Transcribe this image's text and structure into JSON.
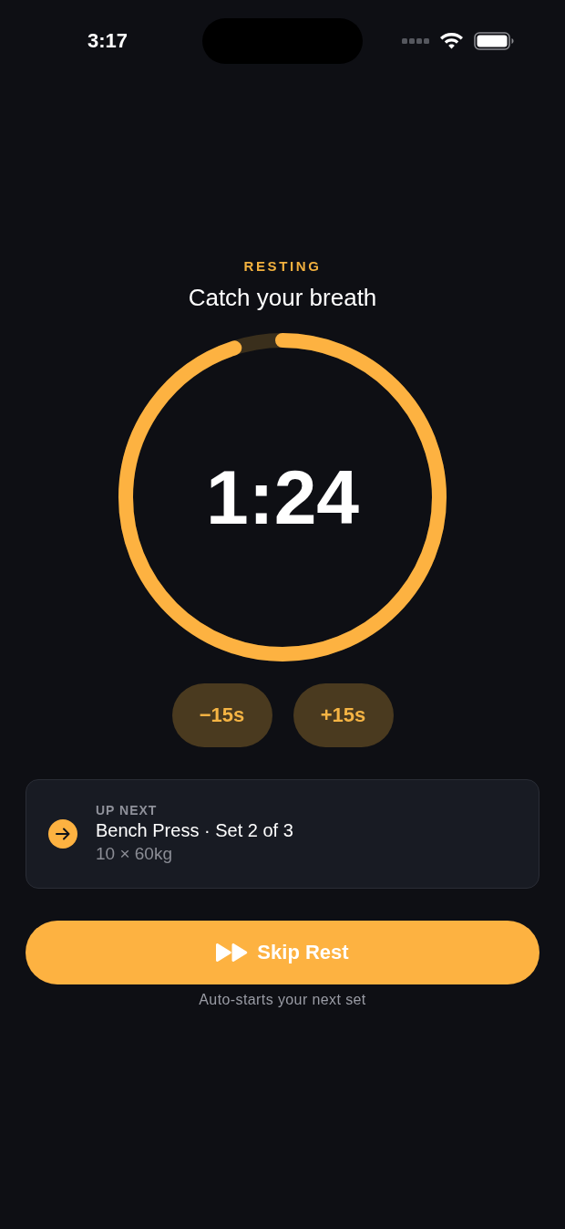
{
  "status_bar": {
    "time": "3:17"
  },
  "header": {
    "eyebrow": "RESTING",
    "title": "Catch your breath"
  },
  "timer": {
    "time": "1:24",
    "level": 0.95
  },
  "adjust_buttons": [
    {
      "label": "−15s"
    },
    {
      "label": "+15s"
    }
  ],
  "up_next": {
    "label": "UP NEXT",
    "title": "Bench Press · Set 2 of 3",
    "detail": "10 × 60kg"
  },
  "primary_button": {
    "label": "Skip Rest"
  },
  "caption": "Auto-starts your next set"
}
